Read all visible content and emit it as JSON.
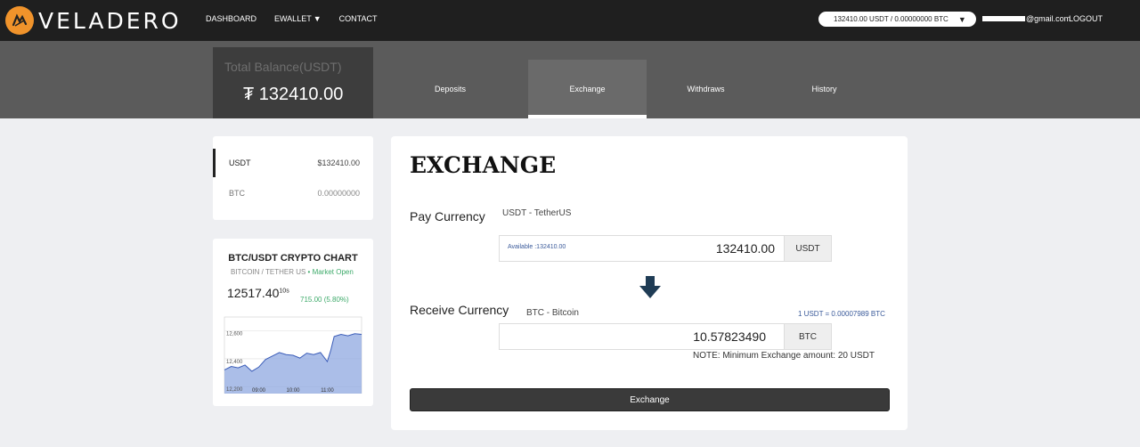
{
  "header": {
    "brand": "VELADERO",
    "nav": [
      {
        "label": "DASHBOARD"
      },
      {
        "label": "EWALLET"
      },
      {
        "label": "CONTACT"
      }
    ],
    "balance_selector": "132410.00 USDT / 0.00000000 BTC",
    "user_email_suffix": "@gmail.com",
    "logout": "LOGOUT"
  },
  "summary": {
    "label": "Total Balance(USDT)",
    "value": "₮ 132410.00"
  },
  "tabs": [
    {
      "label": "Deposits",
      "active": false
    },
    {
      "label": "Exchange",
      "active": true
    },
    {
      "label": "Withdraws",
      "active": false
    },
    {
      "label": "History",
      "active": false
    }
  ],
  "wallets": [
    {
      "currency": "USDT",
      "balance": "$132410.00",
      "active": true
    },
    {
      "currency": "BTC",
      "balance": "0.00000000",
      "active": false
    }
  ],
  "chart_card": {
    "title": "BTC/USDT CRYPTO CHART",
    "subtitle": "BITCOIN / TETHER US",
    "market_status": "• Market Open",
    "price": "12517.40",
    "price_suffix": "10s",
    "change": "715.00 (5.80%)"
  },
  "chart_data": {
    "type": "area",
    "x_ticks": [
      "09:00",
      "10:00",
      "11:00"
    ],
    "y_ticks": [
      "12,600",
      "12,400",
      "12,200"
    ],
    "ylim": [
      12150,
      12700
    ],
    "x_range": [
      8.0,
      12.0
    ],
    "color": "#8fa8e0",
    "line_color": "#3a5cb8",
    "x": [
      8.0,
      8.2,
      8.4,
      8.6,
      8.8,
      9.0,
      9.2,
      9.4,
      9.6,
      9.8,
      10.0,
      10.2,
      10.4,
      10.6,
      10.8,
      11.0,
      11.1,
      11.2,
      11.4,
      11.6,
      11.8,
      12.0
    ],
    "values": [
      12320,
      12345,
      12335,
      12355,
      12310,
      12340,
      12395,
      12420,
      12445,
      12430,
      12425,
      12405,
      12440,
      12430,
      12445,
      12380,
      12460,
      12560,
      12575,
      12565,
      12580,
      12575
    ]
  },
  "exchange": {
    "title": "EXCHANGE",
    "pay_label": "Pay Currency",
    "pay_currency": "USDT - TetherUS",
    "available": "Available :132410.00",
    "pay_amount": "132410.00",
    "pay_unit": "USDT",
    "receive_label": "Receive Currency",
    "receive_currency": "BTC - Bitcoin",
    "rate": "1 USDT = 0.00007989 BTC",
    "receive_amount": "10.57823490",
    "receive_unit": "BTC",
    "note": "NOTE: Minimum Exchange amount: 20 USDT",
    "button": "Exchange"
  },
  "colors": {
    "topbar": "#1f1f1f",
    "band": "#5b5b5b",
    "accent_orange": "#f0932b",
    "market_green": "#3eaa6a"
  }
}
